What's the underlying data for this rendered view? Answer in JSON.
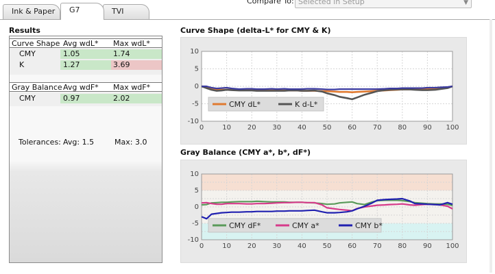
{
  "tabs": [
    {
      "label": "Ink & Paper",
      "active": false
    },
    {
      "label": "G7",
      "active": true
    },
    {
      "label": "TVI",
      "active": false
    }
  ],
  "compare": {
    "label": "Compare To:",
    "value": "Selected in Setup"
  },
  "results": {
    "title": "Results",
    "curve": {
      "headers": [
        "Curve Shape",
        "Avg wdL*",
        "Max wdL*"
      ],
      "rows": [
        {
          "name": "CMY",
          "avg": "1.05",
          "max": "1.74"
        },
        {
          "name": "K",
          "avg": "1.27",
          "max": "3.69"
        }
      ]
    },
    "gray": {
      "headers": [
        "Gray Balance",
        "Avg wdF*",
        "Max wdF*"
      ],
      "rows": [
        {
          "name": "CMY",
          "avg": "0.97",
          "max": "2.02"
        }
      ]
    },
    "tolerances": {
      "label": "Tolerances:",
      "avg": "Avg: 1.5",
      "max": "Max: 3.0"
    }
  },
  "colors": {
    "pass": "#c9e7c8",
    "fail": "#ecc6c6",
    "cmy_dl": "#e07a30",
    "k_dl": "#555555",
    "cmy_df": "#5a9a5a",
    "cmy_a": "#d63a8a",
    "cmy_b": "#2020b0"
  },
  "chart_data": [
    {
      "type": "line",
      "title": "Curve Shape (delta-L* for CMY & K)",
      "xlabel": "",
      "ylabel": "",
      "xlim": [
        0,
        100
      ],
      "ylim": [
        -10,
        10
      ],
      "xticks": [
        0,
        10,
        20,
        30,
        40,
        50,
        60,
        70,
        80,
        90,
        100
      ],
      "yticks": [
        10,
        5,
        0,
        -5,
        -10
      ],
      "grid": true,
      "legend": "bottom-left",
      "x": [
        0,
        2,
        4,
        6,
        8,
        10,
        12,
        15,
        18,
        20,
        22,
        25,
        28,
        30,
        33,
        35,
        38,
        40,
        42,
        45,
        48,
        50,
        53,
        55,
        58,
        60,
        62,
        65,
        68,
        70,
        73,
        75,
        78,
        80,
        83,
        85,
        88,
        90,
        93,
        95,
        98,
        100
      ],
      "series": [
        {
          "name": "CMY dL*",
          "color": "#e07a30",
          "values": [
            0,
            -0.3,
            -0.8,
            -1.0,
            -1.0,
            -1.0,
            -1.0,
            -1.1,
            -1.1,
            -1.1,
            -1.2,
            -1.2,
            -1.2,
            -1.2,
            -1.2,
            -1.2,
            -1.2,
            -1.3,
            -1.3,
            -1.3,
            -1.4,
            -1.4,
            -1.5,
            -1.6,
            -1.6,
            -1.7,
            -1.6,
            -1.5,
            -1.4,
            -1.3,
            -1.2,
            -1.1,
            -1.0,
            -0.9,
            -0.9,
            -0.8,
            -0.8,
            -0.7,
            -0.6,
            -0.5,
            -0.3,
            0
          ]
        },
        {
          "name": "K d-L*",
          "color": "#555555",
          "values": [
            0,
            -0.5,
            -1.0,
            -1.3,
            -1.2,
            -1.0,
            -1.1,
            -1.2,
            -1.2,
            -1.2,
            -1.3,
            -1.3,
            -1.3,
            -1.3,
            -1.3,
            -1.2,
            -1.2,
            -1.3,
            -1.3,
            -1.2,
            -1.5,
            -2.0,
            -2.5,
            -3.0,
            -3.4,
            -3.7,
            -3.2,
            -2.4,
            -1.8,
            -1.4,
            -1.1,
            -1.0,
            -0.9,
            -0.9,
            -0.9,
            -1.0,
            -1.1,
            -1.1,
            -1.0,
            -0.8,
            -0.5,
            0
          ]
        },
        {
          "name": "",
          "color": "#3a3aa0",
          "values": [
            0,
            0,
            -0.4,
            -0.6,
            -0.5,
            -0.4,
            -0.6,
            -0.8,
            -0.7,
            -0.7,
            -0.8,
            -0.8,
            -0.7,
            -0.8,
            -0.7,
            -0.8,
            -0.8,
            -0.8,
            -0.7,
            -0.7,
            -0.8,
            -0.9,
            -0.9,
            -0.8,
            -0.8,
            -0.8,
            -0.8,
            -0.8,
            -0.8,
            -0.8,
            -0.7,
            -0.6,
            -0.6,
            -0.5,
            -0.5,
            -0.5,
            -0.5,
            -0.4,
            -0.4,
            -0.3,
            -0.2,
            0
          ]
        }
      ]
    },
    {
      "type": "line",
      "title": "Gray Balance (CMY a*, b*, dF*)",
      "xlabel": "",
      "ylabel": "",
      "xlim": [
        0,
        100
      ],
      "ylim": [
        -10,
        10
      ],
      "xticks": [
        0,
        10,
        20,
        30,
        40,
        50,
        60,
        70,
        80,
        90,
        100
      ],
      "yticks": [
        10,
        7.5,
        5,
        2.5,
        0,
        -2.5,
        -5,
        -7.5,
        -10
      ],
      "grid": true,
      "legend": "bottom-left",
      "x": [
        0,
        2,
        4,
        6,
        8,
        10,
        12,
        15,
        18,
        20,
        22,
        25,
        28,
        30,
        33,
        35,
        38,
        40,
        42,
        45,
        48,
        50,
        53,
        55,
        58,
        60,
        62,
        65,
        68,
        70,
        73,
        75,
        78,
        80,
        83,
        85,
        88,
        90,
        93,
        95,
        98,
        100
      ],
      "series": [
        {
          "name": "CMY dF*",
          "color": "#5a9a5a",
          "values": [
            0.6,
            0.7,
            1.2,
            1.3,
            1.4,
            1.4,
            1.5,
            1.6,
            1.6,
            1.6,
            1.7,
            1.6,
            1.5,
            1.5,
            1.5,
            1.4,
            1.4,
            1.4,
            1.3,
            1.2,
            1.0,
            0.8,
            0.9,
            1.2,
            1.4,
            1.5,
            1.0,
            0.7,
            1.5,
            1.9,
            2.0,
            2.0,
            2.0,
            1.9,
            1.6,
            1.3,
            1.1,
            1.0,
            0.9,
            0.9,
            0.8,
            0.4
          ]
        },
        {
          "name": "CMY a*",
          "color": "#d63a8a",
          "values": [
            1.2,
            1.3,
            1.0,
            0.8,
            0.8,
            1.0,
            1.0,
            1.0,
            0.9,
            0.9,
            1.0,
            1.0,
            1.1,
            1.2,
            1.3,
            1.3,
            1.4,
            1.4,
            1.3,
            1.3,
            0.6,
            -0.3,
            -0.6,
            -0.8,
            -1.0,
            -1.2,
            -0.5,
            0,
            0.3,
            0.5,
            0.6,
            0.7,
            0.8,
            0.9,
            0.6,
            0.5,
            0.7,
            0.8,
            0.7,
            0.6,
            0.2,
            -0.6
          ]
        },
        {
          "name": "CMY b*",
          "color": "#2020b0",
          "values": [
            -3.0,
            -3.6,
            -2.2,
            -2.0,
            -1.8,
            -1.7,
            -1.6,
            -1.6,
            -1.5,
            -1.5,
            -1.4,
            -1.4,
            -1.4,
            -1.3,
            -1.3,
            -1.2,
            -1.2,
            -1.2,
            -1.1,
            -1.0,
            -1.5,
            -1.8,
            -1.8,
            -1.7,
            -1.5,
            -1.2,
            -0.6,
            0.2,
            1.2,
            2.0,
            2.2,
            2.3,
            2.4,
            2.5,
            1.8,
            1.0,
            0.9,
            0.8,
            0.7,
            0.6,
            1.3,
            0.8
          ]
        }
      ]
    }
  ]
}
